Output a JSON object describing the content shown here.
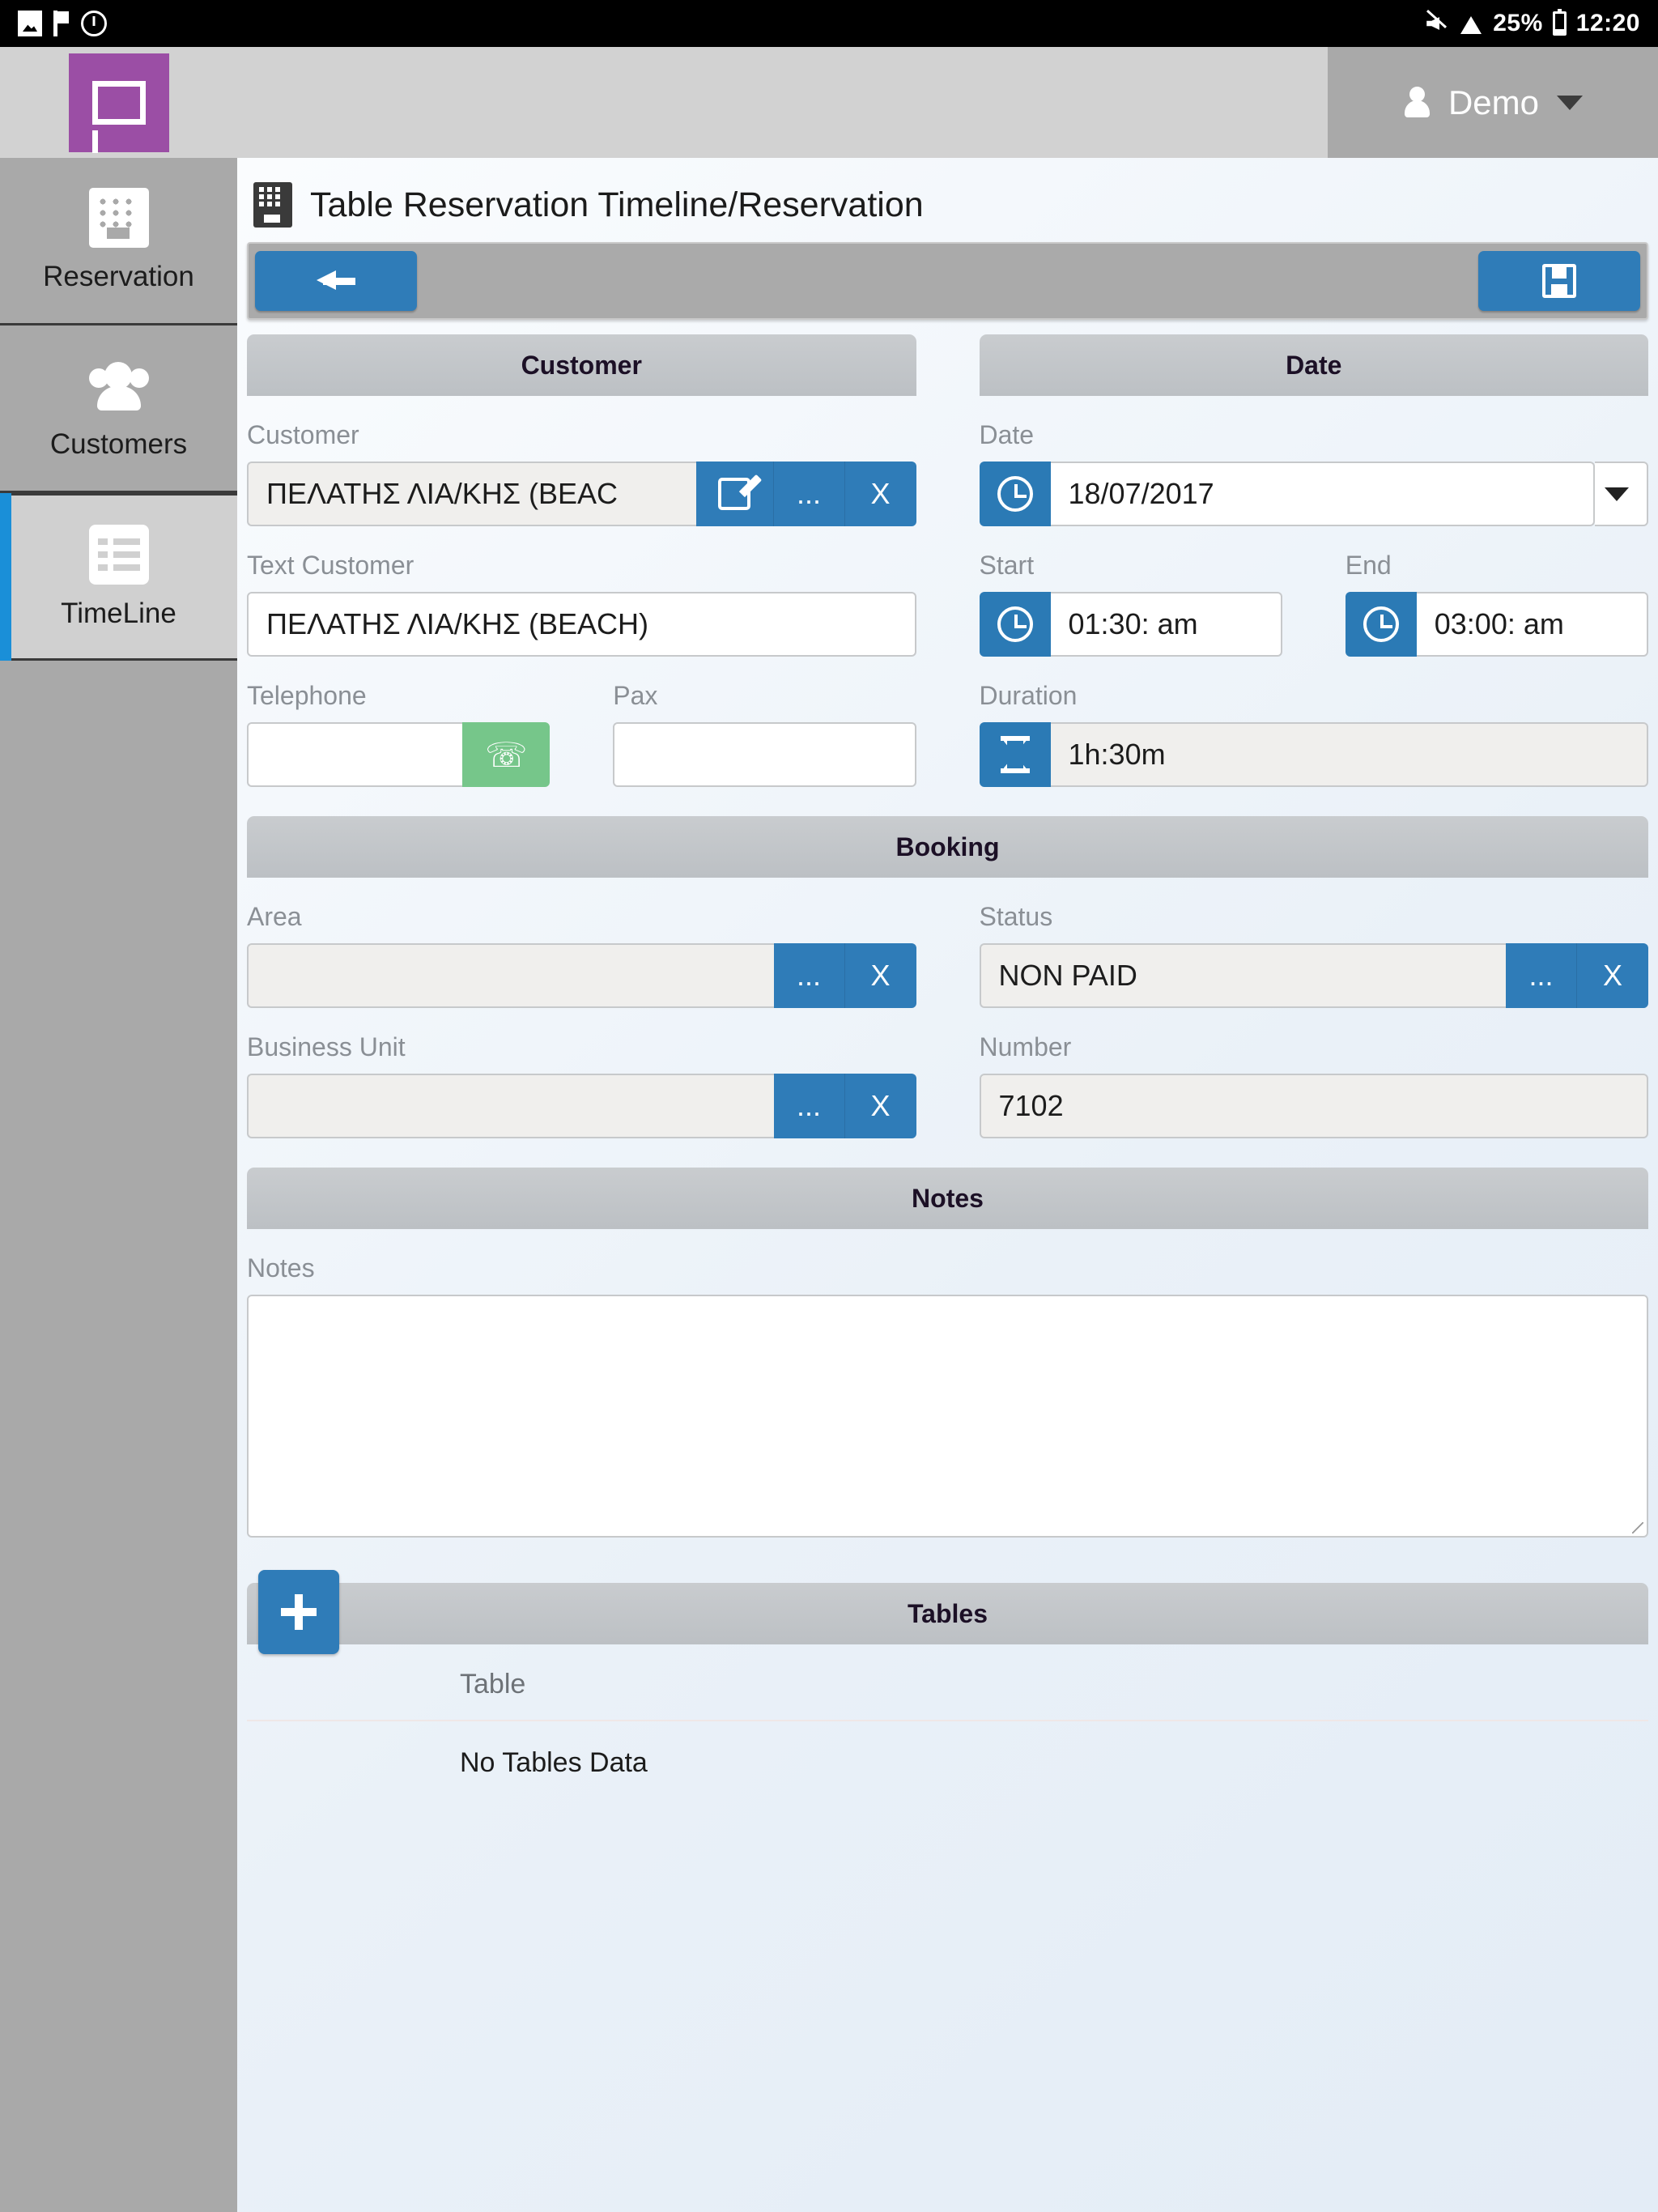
{
  "status_bar": {
    "icons_left": [
      "gallery-icon",
      "flag-icon",
      "clock-app-icon"
    ],
    "mute_icon": "mute-icon",
    "wifi_icon": "wifi-icon",
    "battery_percent": "25%",
    "battery_icon": "battery-icon",
    "time": "12:20"
  },
  "topbar": {
    "logo_name": "app-logo",
    "user_name": "Demo",
    "user_icon": "person-icon",
    "chevron_icon": "chevron-down-icon"
  },
  "sidebar": {
    "items": [
      {
        "label": "Reservation",
        "icon": "building-icon",
        "active": false
      },
      {
        "label": "Customers",
        "icon": "people-icon",
        "active": false
      },
      {
        "label": "TimeLine",
        "icon": "list-icon",
        "active": true
      }
    ]
  },
  "page": {
    "title": "Table Reservation Timeline/Reservation",
    "title_icon": "keypad-icon"
  },
  "toolbar": {
    "back_icon": "arrow-left-icon",
    "save_icon": "floppy-save-icon"
  },
  "customer_panel": {
    "header": "Customer",
    "customer_label": "Customer",
    "customer_value": "ΠΕΛΑΤΗΣ ΛΙΑ/ΚΗΣ (BEAC",
    "edit_icon": "pencil-edit-icon",
    "browse_label": "...",
    "clear_label": "X",
    "text_customer_label": "Text Customer",
    "text_customer_value": "ΠΕΛΑΤΗΣ ΛΙΑ/ΚΗΣ (BEACH)",
    "telephone_label": "Telephone",
    "telephone_value": "",
    "call_icon": "phone-icon",
    "pax_label": "Pax",
    "pax_value": ""
  },
  "date_panel": {
    "header": "Date",
    "date_label": "Date",
    "date_value": "18/07/2017",
    "date_icon": "clock-icon",
    "dropdown_icon": "caret-down-icon",
    "start_label": "Start",
    "start_value": "01:30: am",
    "start_icon": "clock-icon",
    "end_label": "End",
    "end_value": "03:00: am",
    "end_icon": "clock-icon",
    "duration_label": "Duration",
    "duration_value": "1h:30m",
    "duration_icon": "hourglass-icon"
  },
  "booking_panel": {
    "header": "Booking",
    "area_label": "Area",
    "area_value": "",
    "status_label": "Status",
    "status_value": "NON PAID",
    "business_unit_label": "Business Unit",
    "business_unit_value": "",
    "number_label": "Number",
    "number_value": "7102",
    "browse_label": "...",
    "clear_label": "X"
  },
  "notes_panel": {
    "header": "Notes",
    "notes_label": "Notes",
    "notes_value": "",
    "notes_placeholder": ""
  },
  "tables_panel": {
    "header": "Tables",
    "add_icon": "plus-icon",
    "column_header": "Table",
    "empty_message": "No Tables Data"
  },
  "colors": {
    "accent_blue": "#2f7cb8",
    "sidebar_active_bar": "#1a8fd8",
    "logo_purple": "#9b4ea5",
    "call_green": "#76c68a",
    "panel_header_gray": "#c4c8cc"
  }
}
